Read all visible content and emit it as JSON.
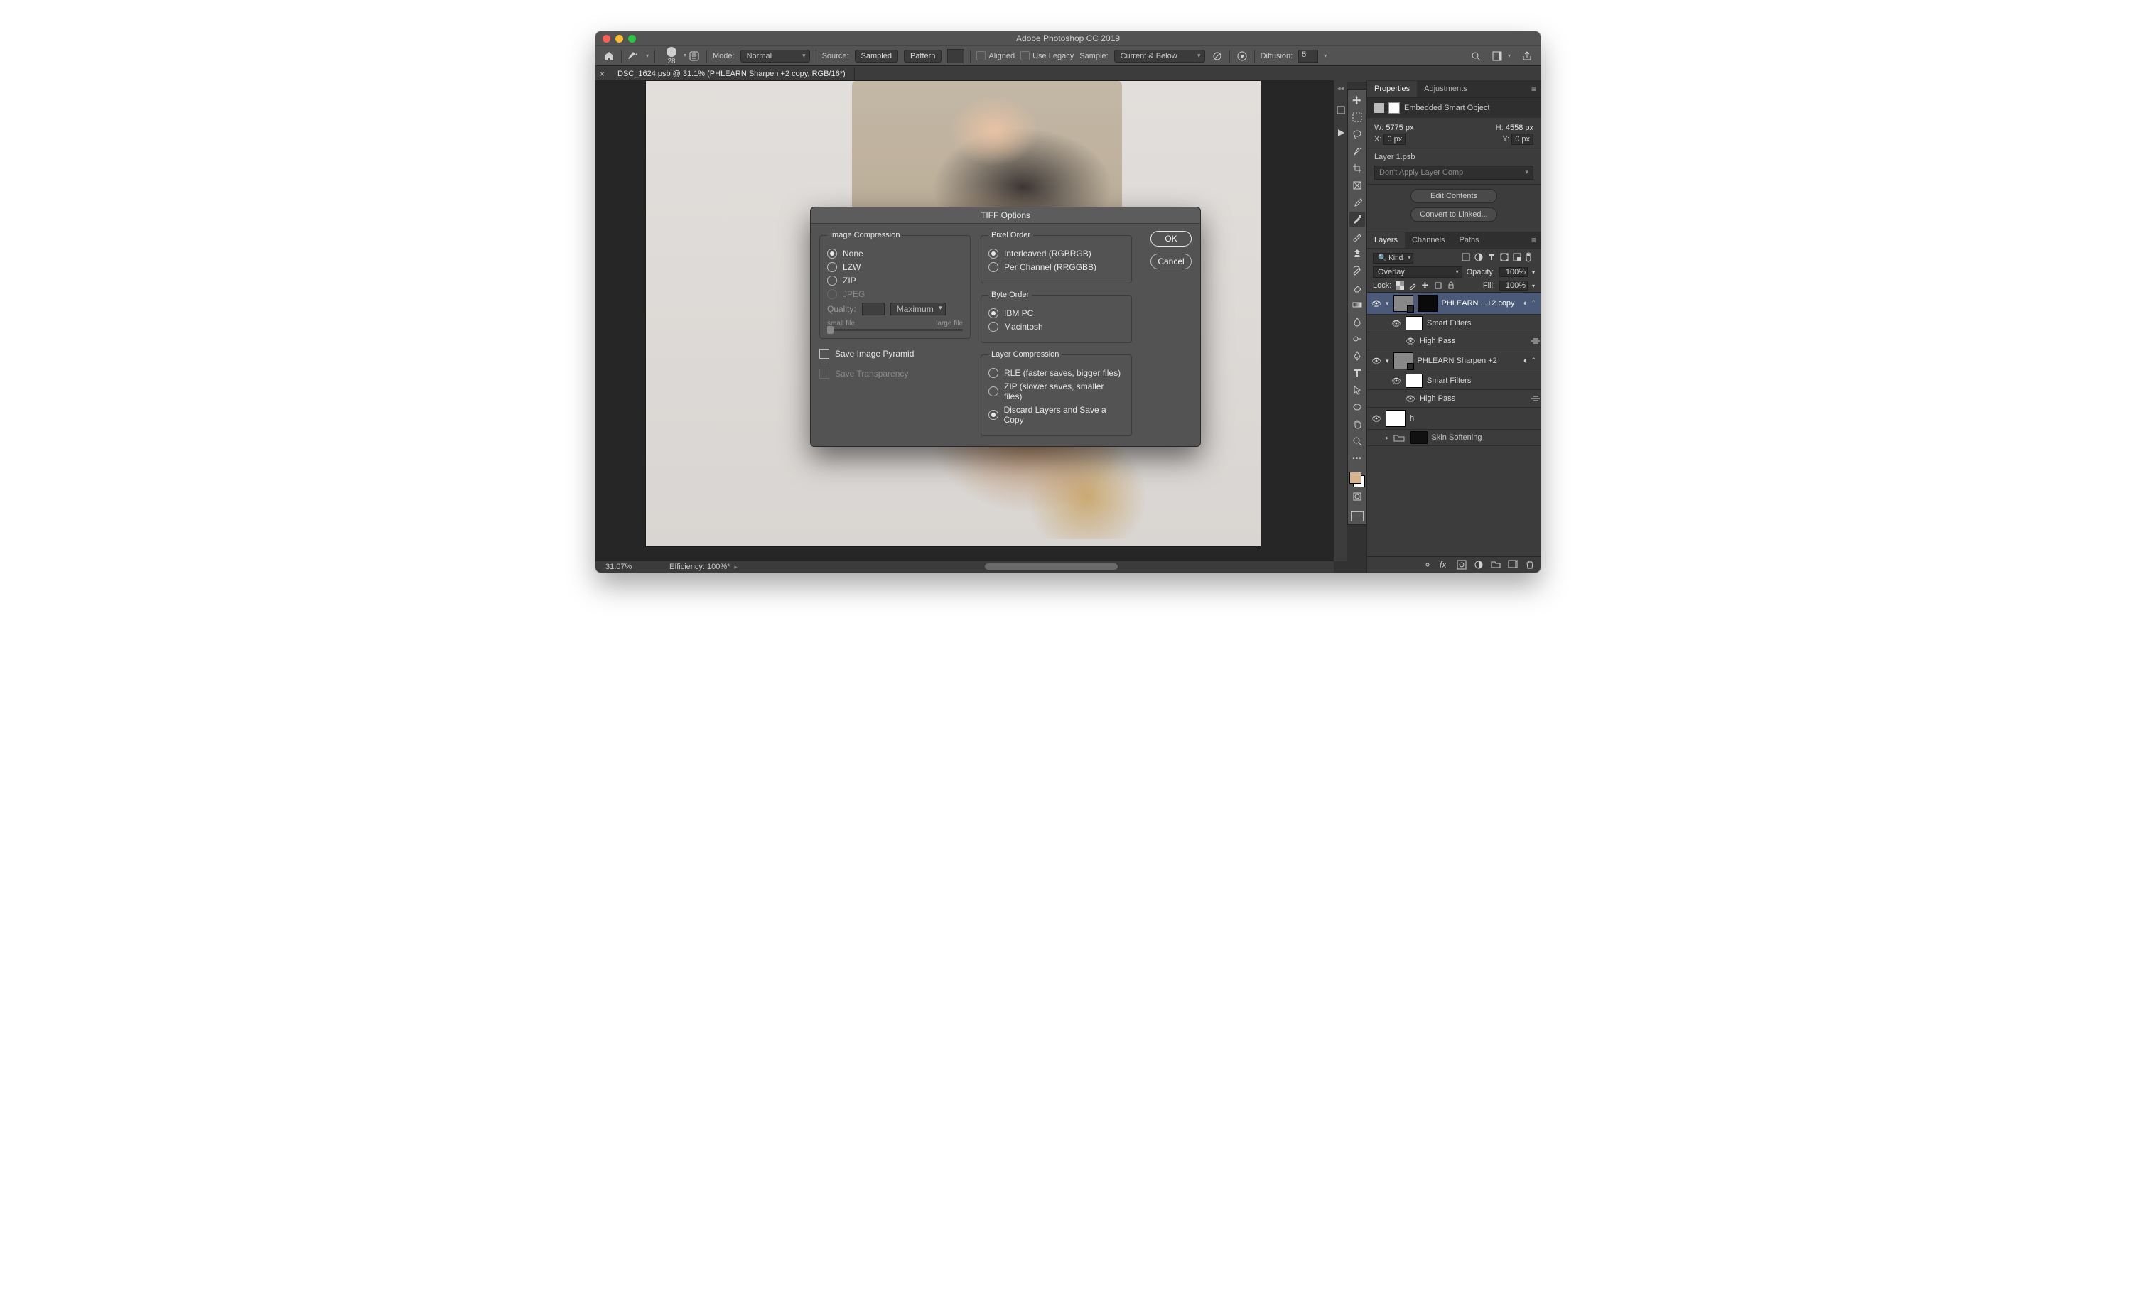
{
  "titlebar": {
    "title": "Adobe Photoshop CC 2019"
  },
  "optionsbar": {
    "brush_size": "28",
    "mode_label": "Mode:",
    "mode_value": "Normal",
    "source_label": "Source:",
    "source_sampled": "Sampled",
    "source_pattern": "Pattern",
    "aligned_label": "Aligned",
    "legacy_label": "Use Legacy",
    "sample_label": "Sample:",
    "sample_value": "Current & Below",
    "diffusion_label": "Diffusion:",
    "diffusion_value": "5"
  },
  "doctab": {
    "label": "DSC_1624.psb @ 31.1% (PHLEARN Sharpen +2 copy, RGB/16*)"
  },
  "statusbar": {
    "zoom": "31.07%",
    "efficiency": "Efficiency: 100%*"
  },
  "properties": {
    "tab_props": "Properties",
    "tab_adj": "Adjustments",
    "header": "Embedded Smart Object",
    "w_label": "W:",
    "w_value": "5775 px",
    "h_label": "H:",
    "h_value": "4558 px",
    "x_label": "X:",
    "x_value": "0 px",
    "y_label": "Y:",
    "y_value": "0 px",
    "linked_name": "Layer 1.psb",
    "layer_comp": "Don't Apply Layer Comp",
    "btn_edit": "Edit Contents",
    "btn_convert": "Convert to Linked..."
  },
  "layers_panel": {
    "tab_layers": "Layers",
    "tab_channels": "Channels",
    "tab_paths": "Paths",
    "kind_label": "Kind",
    "blend_mode": "Overlay",
    "opacity_label": "Opacity:",
    "opacity_value": "100%",
    "lock_label": "Lock:",
    "fill_label": "Fill:",
    "fill_value": "100%",
    "layers": [
      {
        "name": "PHLEARN ...+2 copy",
        "smart": true,
        "selected": true
      },
      {
        "name": "PHLEARN Sharpen +2",
        "smart": true,
        "selected": false
      },
      {
        "name": "h",
        "smart": false,
        "selected": false
      },
      {
        "name": "Skin Softening",
        "smart": false,
        "selected": false,
        "group": true
      }
    ],
    "smart_filters_label": "Smart Filters",
    "high_pass_label": "High Pass"
  },
  "modal": {
    "title": "TIFF Options",
    "btn_ok": "OK",
    "btn_cancel": "Cancel",
    "grp_image_compression": "Image Compression",
    "ic_none": "None",
    "ic_lzw": "LZW",
    "ic_zip": "ZIP",
    "ic_jpeg": "JPEG",
    "quality_label": "Quality:",
    "quality_preset": "Maximum",
    "slider_small": "small file",
    "slider_large": "large file",
    "chk_pyramid": "Save Image Pyramid",
    "chk_transparency": "Save Transparency",
    "grp_pixel_order": "Pixel Order",
    "po_interleaved": "Interleaved (RGBRGB)",
    "po_perchannel": "Per Channel (RRGGBB)",
    "grp_byte_order": "Byte Order",
    "bo_ibm": "IBM PC",
    "bo_mac": "Macintosh",
    "grp_layer_compression": "Layer Compression",
    "lc_rle": "RLE (faster saves, bigger files)",
    "lc_zip": "ZIP (slower saves, smaller files)",
    "lc_discard": "Discard Layers and Save a Copy"
  }
}
